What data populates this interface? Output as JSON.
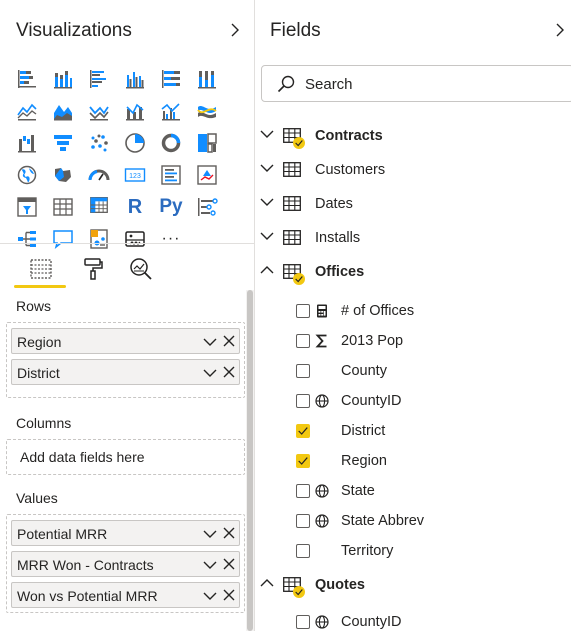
{
  "visualizations": {
    "title": "Visualizations",
    "rows_label": "Rows",
    "columns_label": "Columns",
    "values_label": "Values",
    "columns_placeholder": "Add data fields here",
    "rows": [
      {
        "label": "Region"
      },
      {
        "label": "District"
      }
    ],
    "values": [
      {
        "label": "Potential MRR"
      },
      {
        "label": "MRR Won - Contracts"
      },
      {
        "label": "Won vs Potential MRR"
      }
    ],
    "r_visual": "R",
    "py_visual": "Py",
    "more_visuals": "···",
    "card_visual_text": "123",
    "tabs": [
      "fields-tab",
      "format-tab",
      "analytics-tab"
    ]
  },
  "fields": {
    "title": "Fields",
    "search_placeholder": "Search",
    "tables": [
      {
        "name": "Contracts",
        "expanded": false,
        "has_selection": true
      },
      {
        "name": "Customers",
        "expanded": false,
        "has_selection": false
      },
      {
        "name": "Dates",
        "expanded": false,
        "has_selection": false
      },
      {
        "name": "Installs",
        "expanded": false,
        "has_selection": false
      },
      {
        "name": "Offices",
        "expanded": true,
        "has_selection": true
      },
      {
        "name": "Quotes",
        "expanded": true,
        "has_selection": true
      }
    ],
    "offices_fields": [
      {
        "name": "# of Offices",
        "checked": false,
        "icon": "calculator-icon"
      },
      {
        "name": "2013 Pop",
        "checked": false,
        "icon": "sigma-icon"
      },
      {
        "name": "County",
        "checked": false,
        "icon": ""
      },
      {
        "name": "CountyID",
        "checked": false,
        "icon": "globe-icon"
      },
      {
        "name": "District",
        "checked": true,
        "icon": ""
      },
      {
        "name": "Region",
        "checked": true,
        "icon": ""
      },
      {
        "name": "State",
        "checked": false,
        "icon": "globe-icon"
      },
      {
        "name": "State Abbrev",
        "checked": false,
        "icon": "globe-icon"
      },
      {
        "name": "Territory",
        "checked": false,
        "icon": ""
      }
    ],
    "quotes_fields": [
      {
        "name": "CountyID",
        "checked": false,
        "icon": "globe-icon"
      }
    ]
  },
  "colors": {
    "accent": "#f2c811",
    "chart_blue": "#118dff",
    "icon_gray": "#605e5c"
  }
}
